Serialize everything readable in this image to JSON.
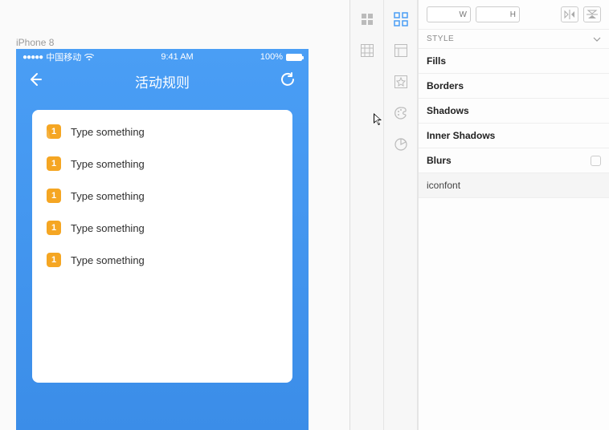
{
  "artboard_label": "iPhone 8",
  "status": {
    "carrier": "中国移动",
    "time": "9:41 AM",
    "battery_pct": "100%"
  },
  "nav": {
    "title": "活动规则"
  },
  "list": {
    "items": [
      {
        "num": "1",
        "text": "Type something"
      },
      {
        "num": "1",
        "text": "Type something"
      },
      {
        "num": "1",
        "text": "Type something"
      },
      {
        "num": "1",
        "text": "Type something"
      },
      {
        "num": "1",
        "text": "Type something"
      }
    ]
  },
  "inspector": {
    "w_label": "W",
    "h_label": "H",
    "style_label": "STYLE",
    "sections": {
      "fills": "Fills",
      "borders": "Borders",
      "shadows": "Shadows",
      "inner_shadows": "Inner Shadows",
      "blurs": "Blurs",
      "iconfont": "iconfont"
    }
  }
}
